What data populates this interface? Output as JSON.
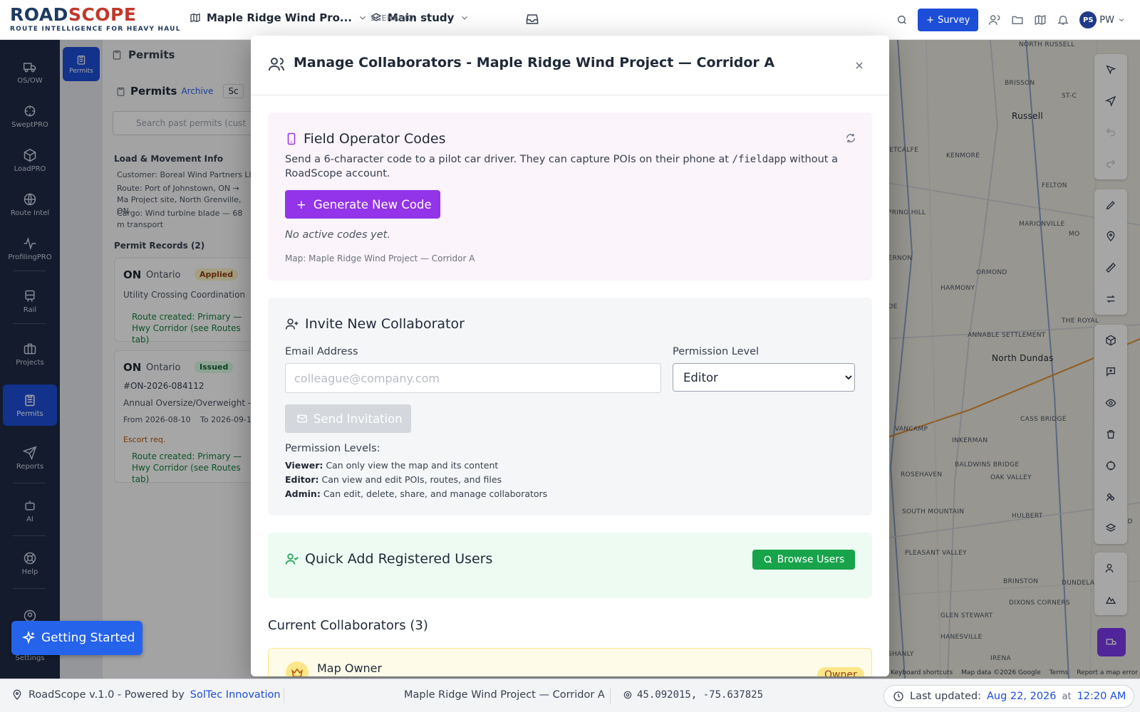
{
  "app": {
    "logo_road": "ROAD",
    "logo_scope": "SCOPE",
    "tagline": "ROUTE INTELLIGENCE FOR HEAVY HAUL",
    "project_name": "Maple Ridge Wind Pro...",
    "scenario_label": "SCENARIO",
    "scenario_value": "Main study",
    "survey_label": "Survey",
    "user_initials": "PS",
    "user_short": "PW"
  },
  "nav": [
    {
      "label": "OS/OW",
      "icon": "truck-icon"
    },
    {
      "label": "SweptPRO",
      "icon": "swept-icon"
    },
    {
      "label": "LoadPRO",
      "icon": "cube-icon"
    },
    {
      "label": "Route Intel",
      "icon": "globe-icon"
    },
    {
      "label": "ProfilingPRO",
      "icon": "pulse-icon"
    },
    {
      "label": "Rail",
      "icon": "train-icon"
    },
    {
      "label": "Projects",
      "icon": "briefcase-icon"
    },
    {
      "label": "Permits",
      "icon": "clipboard-icon"
    },
    {
      "label": "Reports",
      "icon": "send-icon"
    },
    {
      "label": "AI",
      "icon": "robot-icon"
    },
    {
      "label": "Help",
      "icon": "lifebuoy-icon"
    },
    {
      "label": "Settings",
      "icon": "gear-icon"
    }
  ],
  "panel": {
    "rail_tab": "Permits",
    "title": "Permits",
    "subtitle": "Permits",
    "archive": "Archive",
    "schedule": "Sc",
    "search_placeholder": "Search past permits (cust",
    "load_heading": "Load & Movement Info",
    "customer": "Customer: Boreal Wind Partners Ll",
    "route": "Route: Port of Johnstown, ON → Ma Project site, North Grenville, ON",
    "cargo": "Cargo: Wind turbine blade — 68 m transport",
    "records_heading": "Permit Records (2)",
    "records": [
      {
        "state": "ON",
        "province": "Ontario",
        "status": "Applied",
        "desc": "Utility Crossing Coordination",
        "route_note": "Route created: Primary — Hwy Corridor (see Routes tab)"
      },
      {
        "state": "ON",
        "province": "Ontario",
        "status": "Issued",
        "number": "#ON-2026-084112",
        "desc": "Annual Oversize/Overweight -",
        "from": "From 2026-08-10",
        "to": "To 2026-09-1",
        "escort": "Escort req.",
        "route_note": "Route created: Primary — Hwy Corridor (see Routes tab)"
      }
    ]
  },
  "map": {
    "labels": [
      "NORTH RUSSELL",
      "BRISSON",
      "ST-C",
      "Russell",
      "METCALFE",
      "KENMORE",
      "FELTON",
      "SPRING HILL",
      "MARIONVILLE",
      "VERNON",
      "ORMOND",
      "HARMONY",
      "ANNABLE SETTLEMENT",
      "North Dundas",
      "THE ROYAL",
      "VANCAMP",
      "CASS BRIDGE",
      "INKERMAN",
      "ROSEHAVEN",
      "BALDWINS BRIDGE",
      "OAK VALLEY",
      "SOUTH MOUNTAIN",
      "HULBERT",
      "PLEASANT VALLEY",
      "STRAD",
      "BRINSTON",
      "DUNDELA",
      "DIXONS CORNERS",
      "GLEN STEWART",
      "HANESVILLE",
      "SHANLY",
      "IRENA",
      "ADE",
      "MO"
    ],
    "footer": [
      "Keyboard shortcuts",
      "Map data ©2026 Google",
      "Terms",
      "Report a map error"
    ]
  },
  "modal": {
    "title": "Manage Collaborators - Maple Ridge Wind Project — Corridor A",
    "field": {
      "title": "Field Operator Codes",
      "desc_before": "Send a 6-character code to a pilot car driver. They can capture POIs on their phone at ",
      "desc_code": "/fieldapp",
      "desc_after": " without a RoadScope account.",
      "generate": "Generate New Code",
      "no_codes": "No active codes yet.",
      "map_ref": "Map: Maple Ridge Wind Project — Corridor A"
    },
    "invite": {
      "title": "Invite New Collaborator",
      "email_label": "Email Address",
      "email_placeholder": "colleague@company.com",
      "permission_label": "Permission Level",
      "permission_value": "Editor",
      "send": "Send Invitation",
      "levels_heading": "Permission Levels:",
      "levels": [
        {
          "name": "Viewer:",
          "desc": "Can only view the map and its content"
        },
        {
          "name": "Editor:",
          "desc": "Can view and edit POIs, routes, and files"
        },
        {
          "name": "Admin:",
          "desc": "Can edit, delete, share, and manage collaborators"
        }
      ]
    },
    "quick": {
      "title": "Quick Add Registered Users",
      "browse": "Browse Users"
    },
    "collaborators_heading": "Current Collaborators (3)",
    "owner_name": "Map Owner",
    "owner_badge": "Owner"
  },
  "getting_started": "Getting Started",
  "status": {
    "version": "RoadScope v.1.0 - Powered by",
    "brand": "SolTec Innovation",
    "map_name": "Maple Ridge Wind Project — Corridor A",
    "coords": "45.092015, -75.637825",
    "updated_label": "Last updated:",
    "updated_date": "Aug 22, 2026",
    "updated_at": "at",
    "updated_time": "12:20 AM"
  },
  "colors": {
    "accent": "#1d4ed8",
    "purple": "#9333ea",
    "green": "#16a34a",
    "nav_bg": "#1f2a44"
  }
}
